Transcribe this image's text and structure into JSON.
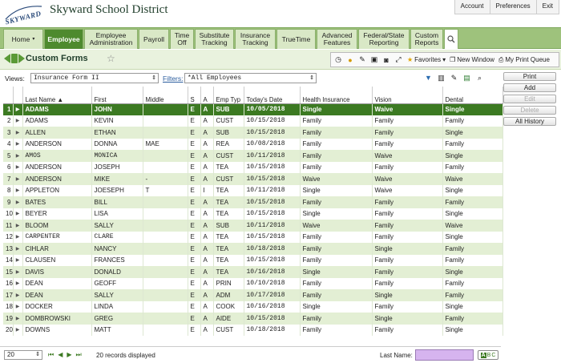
{
  "header": {
    "logo_text": "SKYWARD",
    "district": "Skyward School District",
    "links": [
      "Account",
      "Preferences",
      "Exit"
    ]
  },
  "nav": {
    "tabs": [
      {
        "label": "Home",
        "caret": "▾"
      },
      {
        "label": "Employee",
        "caret": "",
        "active": true
      },
      {
        "label": "Employee Administration"
      },
      {
        "label": "Payroll"
      },
      {
        "label": "Time Off"
      },
      {
        "label": "Substitute Tracking"
      },
      {
        "label": "Insurance Tracking"
      },
      {
        "label": "TrueTime"
      },
      {
        "label": "Advanced Features"
      },
      {
        "label": "Federal/State Reporting"
      },
      {
        "label": "Custom Reports"
      }
    ]
  },
  "page": {
    "title": "Custom Forms"
  },
  "toolbar": {
    "favorites": "Favorites",
    "new_window": "New Window",
    "print_queue": "My Print Queue"
  },
  "views": {
    "label": "Views:",
    "value": "Insurance Form II",
    "filters_label": "Filters:",
    "filter_value": "*All Employees"
  },
  "table": {
    "headers": [
      "Last Name",
      "First",
      "Middle",
      "S",
      "A",
      "Emp Typ",
      "Today's Date",
      "Health Insurance",
      "Vision",
      "Dental"
    ],
    "rows": [
      [
        "1",
        "ADAMS",
        "JOHN",
        "",
        "E",
        "A",
        "SUB",
        "10/05/2018",
        "Single",
        "Waive",
        "Single"
      ],
      [
        "2",
        "ADAMS",
        "KEVIN",
        "",
        "E",
        "A",
        "CUST",
        "10/15/2018",
        "Family",
        "Family",
        "Family"
      ],
      [
        "3",
        "ALLEN",
        "ETHAN",
        "",
        "E",
        "A",
        "SUB",
        "10/15/2018",
        "Family",
        "Family",
        "Single"
      ],
      [
        "4",
        "ANDERSON",
        "DONNA",
        "MAE",
        "E",
        "A",
        "REA",
        "10/08/2018",
        "Family",
        "Family",
        "Family"
      ],
      [
        "5",
        "AMOS",
        "MONICA",
        "",
        "E",
        "A",
        "CUST",
        "10/11/2018",
        "Family",
        "Waive",
        "Single"
      ],
      [
        "6",
        "ANDERSON",
        "JOSEPH",
        "",
        "E",
        "A",
        "TEA",
        "10/15/2018",
        "Family",
        "Family",
        "Family"
      ],
      [
        "7",
        "ANDERSON",
        "MIKE",
        "-",
        "E",
        "A",
        "CUST",
        "10/15/2018",
        "Waive",
        "Waive",
        "Waive"
      ],
      [
        "8",
        "APPLETON",
        "JOESEPH",
        "T",
        "E",
        "I",
        "TEA",
        "10/11/2018",
        "Single",
        "Waive",
        "Single"
      ],
      [
        "9",
        "BATES",
        "BILL",
        "",
        "E",
        "A",
        "TEA",
        "10/15/2018",
        "Family",
        "Family",
        "Family"
      ],
      [
        "10",
        "BEYER",
        "LISA",
        "",
        "E",
        "A",
        "TEA",
        "10/15/2018",
        "Single",
        "Family",
        "Single"
      ],
      [
        "11",
        "BLOOM",
        "SALLY",
        "",
        "E",
        "A",
        "SUB",
        "10/11/2018",
        "Waive",
        "Family",
        "Waive"
      ],
      [
        "12",
        "CARPENTER",
        "CLARE",
        "",
        "E",
        "A",
        "TEA",
        "10/15/2018",
        "Family",
        "Family",
        "Single"
      ],
      [
        "13",
        "CIHLAR",
        "NANCY",
        "",
        "E",
        "A",
        "TEA",
        "10/18/2018",
        "Family",
        "Single",
        "Family"
      ],
      [
        "14",
        "CLAUSEN",
        "FRANCES",
        "",
        "E",
        "A",
        "TEA",
        "10/15/2018",
        "Family",
        "Family",
        "Family"
      ],
      [
        "15",
        "DAVIS",
        "DONALD",
        "",
        "E",
        "A",
        "TEA",
        "10/16/2018",
        "Single",
        "Family",
        "Single"
      ],
      [
        "16",
        "DEAN",
        "GEOFF",
        "",
        "E",
        "A",
        "PRIN",
        "10/10/2018",
        "Family",
        "Family",
        "Family"
      ],
      [
        "17",
        "DEAN",
        "SALLY",
        "",
        "E",
        "A",
        "ADM",
        "10/17/2018",
        "Family",
        "Single",
        "Family"
      ],
      [
        "18",
        "DOCKER",
        "LINDA",
        "",
        "E",
        "A",
        "COOK",
        "10/16/2018",
        "Single",
        "Family",
        "Single"
      ],
      [
        "19",
        "DOMBROWSKI",
        "GREG",
        "",
        "E",
        "A",
        "AIDE",
        "10/15/2018",
        "Family",
        "Single",
        "Family"
      ],
      [
        "20",
        "DOWNS",
        "MATT",
        "",
        "E",
        "A",
        "CUST",
        "10/18/2018",
        "Family",
        "Family",
        "Single"
      ]
    ]
  },
  "side_buttons": {
    "print": "Print",
    "add": "Add",
    "edit": "Edit",
    "delete": "Delete",
    "history": "All History"
  },
  "footer": {
    "page_size": "20",
    "records": "20 records displayed",
    "last_name_label": "Last Name:",
    "abc": [
      "A",
      "B",
      "C"
    ]
  }
}
